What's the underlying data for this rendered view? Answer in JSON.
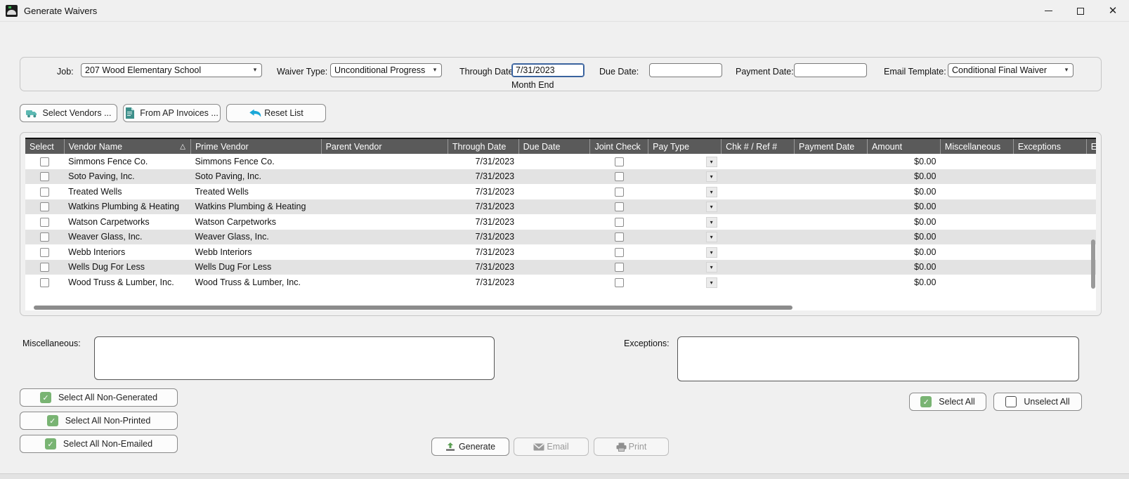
{
  "window": {
    "title": "Generate Waivers",
    "icon": "app-logo-icon",
    "minimize": "—",
    "maximize": "□",
    "close": "✕"
  },
  "filters": {
    "job_label": "Job:",
    "job_value": "207  Wood Elementary School",
    "waiver_type_label": "Waiver Type:",
    "waiver_type_value": "Unconditional Progress",
    "through_date_label": "Through Date:",
    "through_date_value": "7/31/2023",
    "through_date_hint": "Month End",
    "due_date_label": "Due Date:",
    "due_date_value": "",
    "payment_date_label": "Payment Date:",
    "payment_date_value": "",
    "email_template_label": "Email Template:",
    "email_template_value": "Conditional Final Waiver"
  },
  "actionbar": {
    "select_vendors": "Select Vendors ...",
    "from_ap_invoices": "From AP Invoices ...",
    "reset_list": "Reset List"
  },
  "grid": {
    "columns": [
      "Select",
      "Vendor Name",
      "Prime Vendor",
      "Parent Vendor",
      "Through Date",
      "Due Date",
      "Joint Check",
      "Pay Type",
      "Chk # / Ref #",
      "Payment Date",
      "Amount",
      "Miscellaneous",
      "Exceptions",
      "Exception A"
    ],
    "sort_column": "Vendor Name",
    "sort_indicator": "△",
    "rows": [
      {
        "vendor_name": "Simmons Fence Co.",
        "prime_vendor": "Simmons Fence Co.",
        "parent_vendor": "",
        "through_date": "7/31/2023",
        "due_date": "",
        "chk_ref": "",
        "payment_date": "",
        "amount": "$0.00",
        "miscellaneous": "",
        "exceptions": "",
        "exception_amount": ""
      },
      {
        "vendor_name": "Soto Paving, Inc.",
        "prime_vendor": "Soto Paving, Inc.",
        "parent_vendor": "",
        "through_date": "7/31/2023",
        "due_date": "",
        "chk_ref": "",
        "payment_date": "",
        "amount": "$0.00",
        "miscellaneous": "",
        "exceptions": "",
        "exception_amount": ""
      },
      {
        "vendor_name": "Treated Wells",
        "prime_vendor": "Treated Wells",
        "parent_vendor": "",
        "through_date": "7/31/2023",
        "due_date": "",
        "chk_ref": "",
        "payment_date": "",
        "amount": "$0.00",
        "miscellaneous": "",
        "exceptions": "",
        "exception_amount": ""
      },
      {
        "vendor_name": "Watkins Plumbing & Heating",
        "prime_vendor": "Watkins Plumbing & Heating",
        "parent_vendor": "",
        "through_date": "7/31/2023",
        "due_date": "",
        "chk_ref": "",
        "payment_date": "",
        "amount": "$0.00",
        "miscellaneous": "",
        "exceptions": "",
        "exception_amount": ""
      },
      {
        "vendor_name": "Watson Carpetworks",
        "prime_vendor": "Watson Carpetworks",
        "parent_vendor": "",
        "through_date": "7/31/2023",
        "due_date": "",
        "chk_ref": "",
        "payment_date": "",
        "amount": "$0.00",
        "miscellaneous": "",
        "exceptions": "",
        "exception_amount": ""
      },
      {
        "vendor_name": "Weaver Glass, Inc.",
        "prime_vendor": "Weaver Glass, Inc.",
        "parent_vendor": "",
        "through_date": "7/31/2023",
        "due_date": "",
        "chk_ref": "",
        "payment_date": "",
        "amount": "$0.00",
        "miscellaneous": "",
        "exceptions": "",
        "exception_amount": ""
      },
      {
        "vendor_name": "Webb Interiors",
        "prime_vendor": "Webb Interiors",
        "parent_vendor": "",
        "through_date": "7/31/2023",
        "due_date": "",
        "chk_ref": "",
        "payment_date": "",
        "amount": "$0.00",
        "miscellaneous": "",
        "exceptions": "",
        "exception_amount": ""
      },
      {
        "vendor_name": "Wells Dug For Less",
        "prime_vendor": "Wells Dug For Less",
        "parent_vendor": "",
        "through_date": "7/31/2023",
        "due_date": "",
        "chk_ref": "",
        "payment_date": "",
        "amount": "$0.00",
        "miscellaneous": "",
        "exceptions": "",
        "exception_amount": ""
      },
      {
        "vendor_name": "Wood Truss & Lumber, Inc.",
        "prime_vendor": "Wood Truss & Lumber, Inc.",
        "parent_vendor": "",
        "through_date": "7/31/2023",
        "due_date": "",
        "chk_ref": "",
        "payment_date": "",
        "amount": "$0.00",
        "miscellaneous": "",
        "exceptions": "",
        "exception_amount": ""
      }
    ]
  },
  "bottom": {
    "miscellaneous_label": "Miscellaneous:",
    "miscellaneous_value": "",
    "exceptions_label": "Exceptions:",
    "exceptions_value": "",
    "select_all_non_generated": "Select All Non-Generated",
    "select_all_non_printed": "Select All Non-Printed",
    "select_all_non_emailed": "Select All Non-Emailed",
    "select_all": "Select All",
    "unselect_all": "Unselect All",
    "generate": "Generate",
    "email": "Email",
    "print": "Print"
  },
  "colors": {
    "accent_green": "#79b473",
    "teal_icon": "#4aa8a0",
    "header_gray": "#5a5a5a",
    "row_alt": "#e3e3e3",
    "window_bg": "#f0f0f0"
  }
}
